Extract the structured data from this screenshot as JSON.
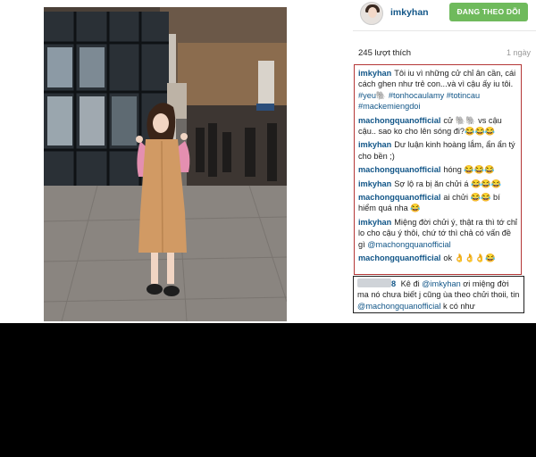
{
  "post": {
    "username": "imkyhan",
    "follow_label": "ĐANG THEO DÕI",
    "likes": "245 lượt thích",
    "time_ago": "1 ngày"
  },
  "comments": [
    {
      "user": "imkyhan",
      "text": "Tôi iu vì những cử chỉ ân cần, cái cách ghen như trẻ con...và vì cậu ấy iu tôi.",
      "tags": "#yeu🐘 #tonhocaulamy #totincau #mackemiengdoi"
    },
    {
      "user": "machongquanofficial",
      "text": "cử 🐘🐘 vs cậu cậu.. sao ko cho lên sóng đi?😂😂😂"
    },
    {
      "user": "imkyhan",
      "text": "Dư luận kinh hoàng lắm, ẩn ẩn tý cho bền ;)"
    },
    {
      "user": "machongquanofficial",
      "text": "hóng 😂😂😂"
    },
    {
      "user": "imkyhan",
      "text": "Sợ lộ ra bị ăn chửi á 😂😂😂"
    },
    {
      "user": "machongquanofficial",
      "text": "ai chửi 😂😂 bí hiểm quá nha 😂"
    },
    {
      "user": "imkyhan",
      "text": "Miệng đời chửi ý, thật ra thì tớ chỉ lo cho cậu ý thôi, chứ tớ thì chả có vấn đề gì",
      "mention": "@machongquanofficial"
    },
    {
      "user": "machongquanofficial",
      "text": "ok 👌👌👌😂"
    }
  ],
  "highlight_comment": {
    "suffix": "8",
    "text_a": " Kê đi ",
    "mention_a": "@imkyhan",
    "text_b": " ơi miệng đời ma nó chưa biết j cũng ùa theo chửi thoii, tin ",
    "mention_b": "@machongquanofficial",
    "text_c": " k có như"
  },
  "colors": {
    "follow_button": "#6fba5c",
    "username_link": "#125688",
    "highlight_border_red": "#b43636",
    "highlight_border_black": "#222222"
  },
  "icons": {
    "avatar": "profile-photo",
    "photo": "woman-in-camel-coat-posing-at-station"
  }
}
